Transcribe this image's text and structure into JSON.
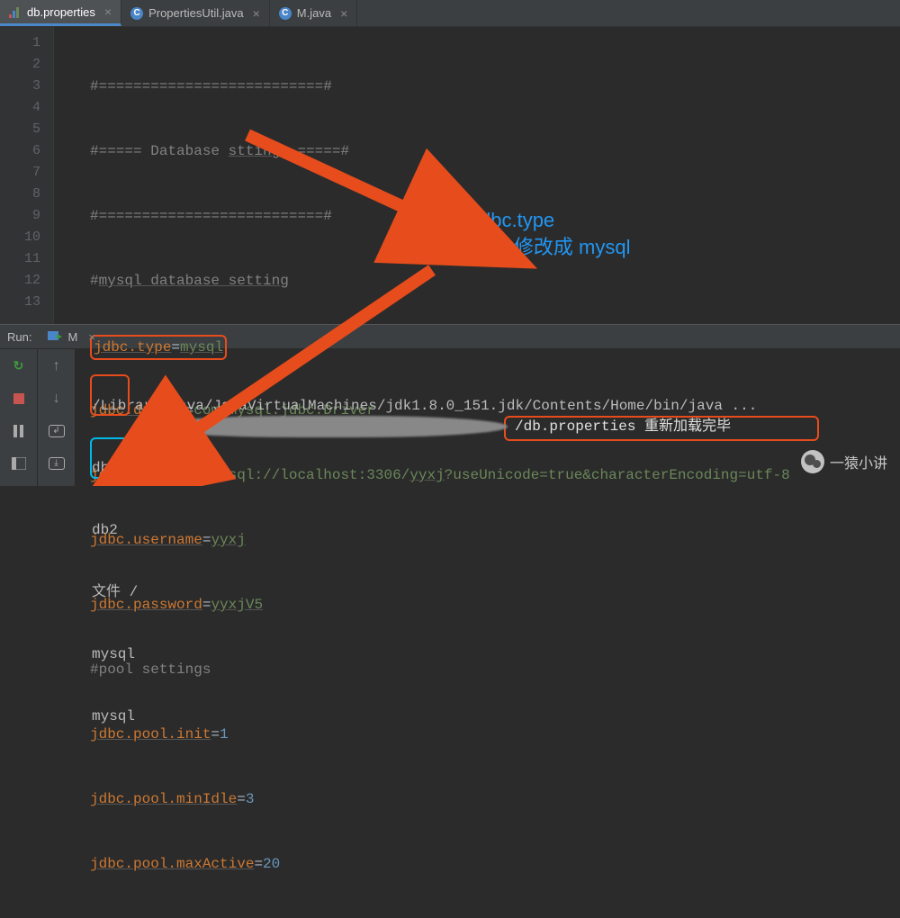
{
  "tabs": [
    {
      "label": "db.properties",
      "active": true,
      "icon": "props"
    },
    {
      "label": "PropertiesUtil.java",
      "active": false,
      "icon": "java"
    },
    {
      "label": "M.java",
      "active": false,
      "icon": "java"
    }
  ],
  "icon_java_letter": "C",
  "gutter_lines": [
    "1",
    "2",
    "3",
    "4",
    "5",
    "6",
    "7",
    "8",
    "9",
    "10",
    "11",
    "12",
    "13"
  ],
  "code": {
    "l1": "#==========================#",
    "l2_a": "#===== Database ",
    "l2_b": "sttings",
    "l2_c": " =====#",
    "l3": "#==========================#",
    "l4_a": "#",
    "l4_b": "mysql database setting",
    "l5_key": "jdbc.type",
    "l5_eq": "=",
    "l5_val": "mysql",
    "l6_key": "jdbc.driver",
    "l6_val": "com.mysql.jdbc.Driver",
    "l7_key": "jdbc.url",
    "l7_val_a": "jdbc:mysql://localhost:3306/",
    "l7_val_b": "yyxj",
    "l7_val_c": "?useUnicode=true&characterEncoding=utf-8",
    "l8_key": "jdbc.username",
    "l8_val": "yyxj",
    "l9_key": "jdbc.password",
    "l9_val": "yyxjV5",
    "l10": "#pool settings",
    "l11_key": "jdbc.pool.init",
    "l11_val": "1",
    "l12_key": "jdbc.pool.minIdle",
    "l12_val": "3",
    "l13_key": "jdbc.pool.maxActive",
    "l13_val": "20"
  },
  "run": {
    "label": "Run:",
    "config": "M",
    "close": "×"
  },
  "console": {
    "cmd": "/Library/Java/JavaVirtualMachines/jdk1.8.0_151.jdk/Contents/Home/bin/java ...",
    "db2_1": "db2",
    "db2_2": "db2",
    "file_label": "文件 /",
    "reload_path": "/db.properties",
    "reload_suffix": " 重新加载完毕",
    "mysql_1": "mysql",
    "mysql_2": "mysql"
  },
  "annotation": {
    "line1": "把 jdbc.type",
    "line2": "从 db2 修改成 mysql"
  },
  "watermark": "一猿小讲",
  "colors": {
    "red": "#e74c1c",
    "cyan": "#00b9e8",
    "blue_text": "#2196f3"
  }
}
